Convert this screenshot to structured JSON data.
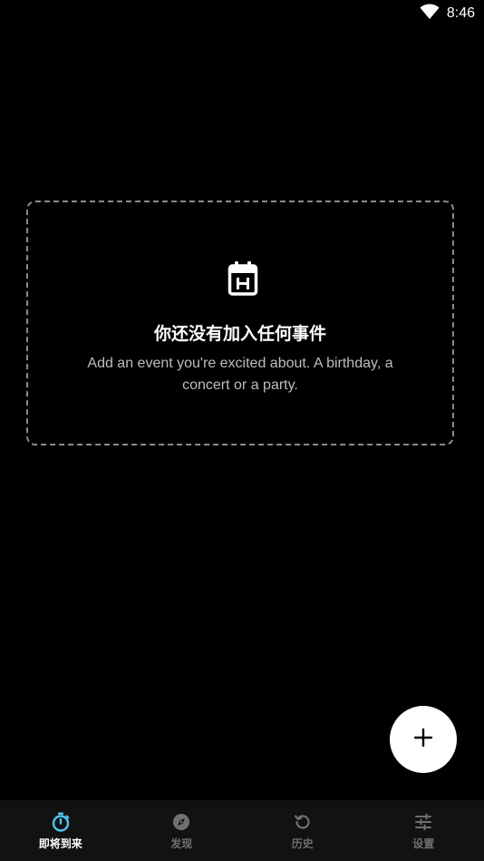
{
  "status_bar": {
    "time": "8:46"
  },
  "empty_state": {
    "icon": "calendar-icon",
    "title": "你还没有加入任何事件",
    "description": "Add an event you're excited about. A birthday, a concert or a party."
  },
  "fab": {
    "icon": "plus-icon"
  },
  "bottom_nav": {
    "items": [
      {
        "label": "即将到来",
        "icon": "stopwatch-icon",
        "active": true
      },
      {
        "label": "发现",
        "icon": "compass-icon",
        "active": false
      },
      {
        "label": "历史",
        "icon": "history-icon",
        "active": false
      },
      {
        "label": "设置",
        "icon": "sliders-icon",
        "active": false
      }
    ]
  },
  "colors": {
    "background": "#000000",
    "accent": "#4fc3f7",
    "nav_background": "#121212",
    "inactive": "#6f6f6f",
    "dashed_border": "#8a8a8a"
  }
}
